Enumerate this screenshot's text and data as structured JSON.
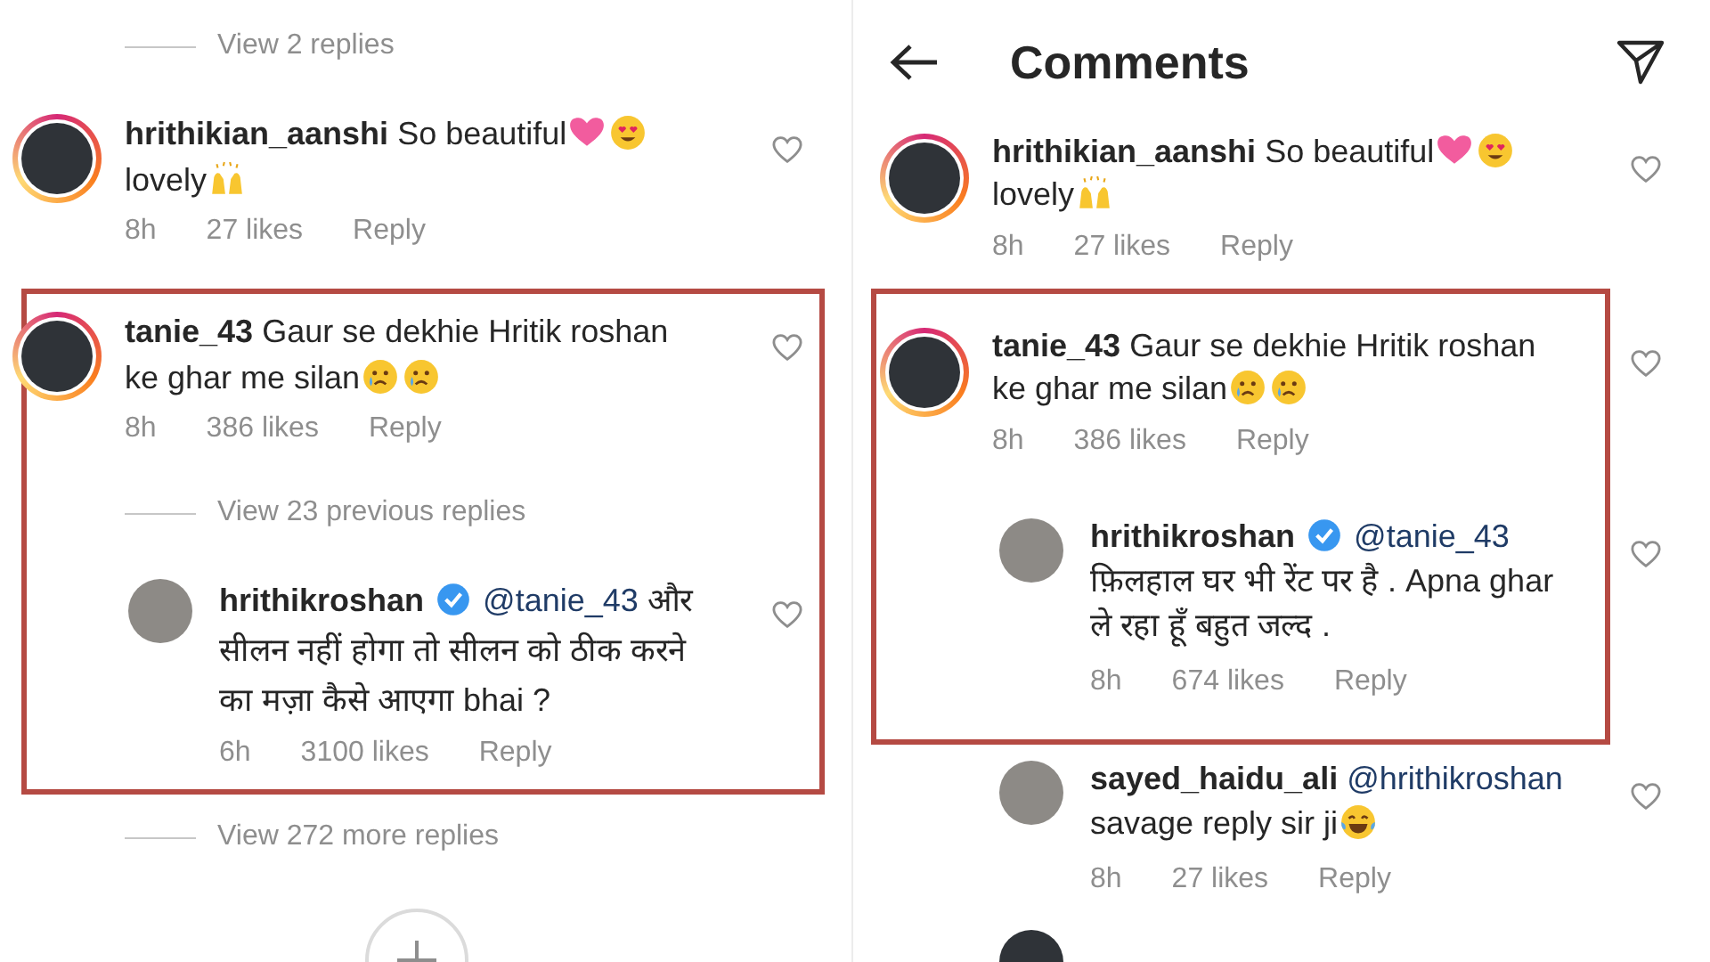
{
  "panels": [
    {
      "items": [
        {
          "kind": "view_replies",
          "text": "View 2 replies"
        },
        {
          "kind": "comment",
          "reply": false,
          "story_ring": true,
          "lines": [
            [
              {
                "kind": "user",
                "text": "hrithikian_aanshi"
              },
              {
                "kind": "text",
                "text": "So beautiful"
              },
              {
                "kind": "heart"
              },
              {
                "kind": "heart-eyes"
              }
            ],
            [
              {
                "kind": "text",
                "text": "lovely"
              },
              {
                "kind": "raised-hands"
              }
            ]
          ],
          "time": "8h",
          "likes": "27 likes",
          "reply_label": "Reply"
        },
        {
          "kind": "highlight",
          "items": [
            {
              "kind": "comment",
              "reply": false,
              "story_ring": true,
              "lines": [
                [
                  {
                    "kind": "user",
                    "text": "tanie_43"
                  },
                  {
                    "kind": "text",
                    "text": "Gaur se dekhie Hritik roshan"
                  }
                ],
                [
                  {
                    "kind": "text",
                    "text": "ke ghar me silan"
                  },
                  {
                    "kind": "crying"
                  },
                  {
                    "kind": "crying"
                  }
                ]
              ],
              "time": "8h",
              "likes": "386 likes",
              "reply_label": "Reply"
            },
            {
              "kind": "view_replies",
              "text": "View 23 previous replies"
            },
            {
              "kind": "comment",
              "reply": true,
              "story_ring": false,
              "lines": [
                [
                  {
                    "kind": "user",
                    "text": "hrithikroshan"
                  },
                  {
                    "kind": "verified"
                  },
                  {
                    "kind": "mention",
                    "text": "@tanie_43"
                  },
                  {
                    "kind": "text",
                    "text": "और"
                  }
                ],
                [
                  {
                    "kind": "text",
                    "text": "सीलन नहीं होगा तो सीलन को ठीक करने"
                  }
                ],
                [
                  {
                    "kind": "text",
                    "text": "का मज़ा कैसे आएगा bhai ?"
                  }
                ]
              ],
              "time": "6h",
              "likes": "3100 likes",
              "reply_label": "Reply"
            }
          ]
        },
        {
          "kind": "view_replies",
          "text": "View 272 more replies"
        },
        {
          "kind": "add_button"
        }
      ]
    },
    {
      "header": {
        "title": "Comments"
      },
      "items": [
        {
          "kind": "comment",
          "reply": false,
          "story_ring": true,
          "lines": [
            [
              {
                "kind": "user",
                "text": "hrithikian_aanshi"
              },
              {
                "kind": "text",
                "text": "So beautiful"
              },
              {
                "kind": "heart"
              },
              {
                "kind": "heart-eyes"
              }
            ],
            [
              {
                "kind": "text",
                "text": "lovely"
              },
              {
                "kind": "raised-hands"
              }
            ]
          ],
          "time": "8h",
          "likes": "27 likes",
          "reply_label": "Reply"
        },
        {
          "kind": "highlight",
          "items": [
            {
              "kind": "comment",
              "reply": false,
              "story_ring": true,
              "lines": [
                [
                  {
                    "kind": "user",
                    "text": "tanie_43"
                  },
                  {
                    "kind": "text",
                    "text": "Gaur se dekhie Hritik roshan"
                  }
                ],
                [
                  {
                    "kind": "text",
                    "text": "ke ghar me silan"
                  },
                  {
                    "kind": "crying"
                  },
                  {
                    "kind": "crying"
                  }
                ]
              ],
              "time": "8h",
              "likes": "386 likes",
              "reply_label": "Reply"
            },
            {
              "kind": "comment",
              "reply": true,
              "story_ring": false,
              "lines": [
                [
                  {
                    "kind": "user",
                    "text": "hrithikroshan"
                  },
                  {
                    "kind": "verified"
                  },
                  {
                    "kind": "mention",
                    "text": "@tanie_43"
                  }
                ],
                [
                  {
                    "kind": "text",
                    "text": "फ़िलहाल घर भी रेंट पर है . Apna ghar"
                  }
                ],
                [
                  {
                    "kind": "text",
                    "text": "ले रहा हूँ बहुत जल्द ."
                  }
                ]
              ],
              "time": "8h",
              "likes": "674 likes",
              "reply_label": "Reply"
            }
          ]
        },
        {
          "kind": "comment",
          "reply": true,
          "story_ring": false,
          "lines": [
            [
              {
                "kind": "user",
                "text": "sayed_haidu_ali"
              },
              {
                "kind": "mention",
                "text": "@hrithikroshan"
              }
            ],
            [
              {
                "kind": "text",
                "text": "savage reply sir ji"
              },
              {
                "kind": "laughing"
              }
            ]
          ],
          "time": "8h",
          "likes": "27 likes",
          "reply_label": "Reply"
        },
        {
          "kind": "avatar_partial"
        }
      ]
    }
  ]
}
